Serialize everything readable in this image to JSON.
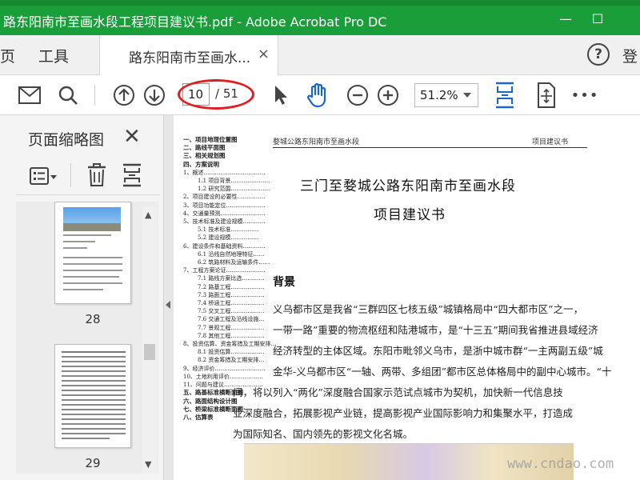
{
  "window": {
    "title": "路东阳南市至画水段工程项目建议书.pdf - Adobe Acrobat Pro DC",
    "minimize": "—",
    "maximize": "☐"
  },
  "tabs": {
    "home": "页",
    "tools": "工具",
    "document_tab": "路东阳南市至画水...",
    "close": "×",
    "help": "?",
    "login": "登"
  },
  "toolbar": {
    "page_current": "10",
    "page_total": "/ 51",
    "zoom": "51.2%",
    "more": "•••"
  },
  "sidebar": {
    "title": "页面缩略图",
    "close": "✕",
    "thumbnails": [
      {
        "label": "28"
      },
      {
        "label": "29"
      }
    ]
  },
  "document": {
    "header_left": "婺城公路东阳南市至画水段",
    "header_right": "项目建议书",
    "title_line1": "三门至婺城公路东阳南市至画水段",
    "title_line2": "项目建议书",
    "section_heading": "背景",
    "paragraph_lines": [
      "义乌都市区是我省“三群四区七核五级”城镇格局中“四大都市区”之一，",
      "一带一路”重要的物流枢纽和陆港城市，是“十三五”期间我省推进县域经济",
      "经济转型的主体区域。东阳市毗邻义乌市，是浙中城市群“一主两副五级”城",
      "金华-义乌都市区“一轴、两带、多组团”都市区总体格局中的副中心城市。“十",
      "间，将以列入“两化”深度融合国家示范试点城市为契机，加快新一代信息技",
      "业深度融合，拓展影视产业链，提高影视产业国际影响力和集聚水平，打造成",
      "为国际知名、国内领先的影视文化名城。"
    ],
    "toc": [
      {
        "t": "一、项目地理位置图",
        "c": "sec"
      },
      {
        "t": "二、路线平面图",
        "c": "sec"
      },
      {
        "t": "三、相关规划图",
        "c": "sec"
      },
      {
        "t": "四、方案说明",
        "c": "sec"
      },
      {
        "t": "1、概述……………………………",
        "c": ""
      },
      {
        "t": "1.1 项目背景…………………",
        "c": "sub2"
      },
      {
        "t": "1.2 研究范围…………………",
        "c": "sub2"
      },
      {
        "t": "2、项目建设的必要性……………",
        "c": ""
      },
      {
        "t": "3、项目功能定位…………………",
        "c": ""
      },
      {
        "t": "4、交通量预测……………………",
        "c": ""
      },
      {
        "t": "5、技术标准及建设规模…………",
        "c": ""
      },
      {
        "t": "5.1 技术标准……………",
        "c": "sub2"
      },
      {
        "t": "5.2 建设规模……………",
        "c": "sub2"
      },
      {
        "t": "6、建设条件和基础资料…………",
        "c": ""
      },
      {
        "t": "6.1 沿线自然地理特征……",
        "c": "sub2"
      },
      {
        "t": "6.2 筑路材料及运输条件……",
        "c": "sub2"
      },
      {
        "t": "7、工程方案论证…………………",
        "c": ""
      },
      {
        "t": "7.1 路线方案比选…………",
        "c": "sub2"
      },
      {
        "t": "7.2 路基工程………………",
        "c": "sub2"
      },
      {
        "t": "7.3 路面工程………………",
        "c": "sub2"
      },
      {
        "t": "7.4 桥涵工程………………",
        "c": "sub2"
      },
      {
        "t": "7.5 交叉工程………………",
        "c": "sub2"
      },
      {
        "t": "7.6 交通工程及沿线设施…",
        "c": "sub2"
      },
      {
        "t": "7.7 景观工程………………",
        "c": "sub2"
      },
      {
        "t": "7.8 其他工程………………",
        "c": "sub2"
      },
      {
        "t": "8、投资估算、资金筹措及工期安排…",
        "c": ""
      },
      {
        "t": "8.1 投资估算………………",
        "c": "sub2"
      },
      {
        "t": "8.2 资金筹措及工期安排…",
        "c": "sub2"
      },
      {
        "t": "9、经济评价………………………",
        "c": ""
      },
      {
        "t": "10、土地利用评价………………",
        "c": ""
      },
      {
        "t": "11、问题与建议…………………",
        "c": ""
      },
      {
        "t": "五、路基标准横断面图",
        "c": "sec"
      },
      {
        "t": "六、路面结构设计图",
        "c": "sec"
      },
      {
        "t": "七、桥梁标准横断面图",
        "c": "sec"
      },
      {
        "t": "八、估算表",
        "c": "sec"
      }
    ]
  },
  "watermark": "www.cndao.com",
  "colors": {
    "titlebar": "#1a9e3a",
    "accent_blue": "#1a66cc",
    "annotation_red": "#e02020"
  }
}
